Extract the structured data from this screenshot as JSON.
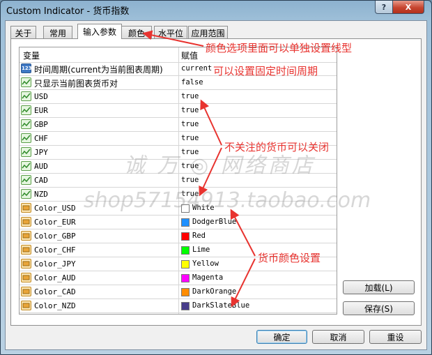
{
  "window": {
    "title": "Custom Indicator - 货币指数",
    "help_label": "?",
    "close_label": "X"
  },
  "tabs": [
    {
      "label": "关于",
      "active": false
    },
    {
      "label": "常用",
      "active": false
    },
    {
      "label": "输入参数",
      "active": true
    },
    {
      "label": "颜色",
      "active": false
    },
    {
      "label": "水平位",
      "active": false
    },
    {
      "label": "应用范围",
      "active": false
    }
  ],
  "grid": {
    "columns": {
      "variable": "变量",
      "value": "赋值"
    },
    "rows": [
      {
        "name": "时间周期(current为当前图表周期)",
        "value": "current",
        "icon": "numeric-param-icon"
      },
      {
        "name": "只显示当前图表货币对",
        "value": "false",
        "icon": "bool-param-icon"
      },
      {
        "name": "USD",
        "value": "true",
        "icon": "bool-param-icon"
      },
      {
        "name": "EUR",
        "value": "true",
        "icon": "bool-param-icon"
      },
      {
        "name": "GBP",
        "value": "true",
        "icon": "bool-param-icon"
      },
      {
        "name": "CHF",
        "value": "true",
        "icon": "bool-param-icon"
      },
      {
        "name": "JPY",
        "value": "true",
        "icon": "bool-param-icon"
      },
      {
        "name": "AUD",
        "value": "true",
        "icon": "bool-param-icon"
      },
      {
        "name": "CAD",
        "value": "true",
        "icon": "bool-param-icon"
      },
      {
        "name": "NZD",
        "value": "true",
        "icon": "bool-param-icon"
      },
      {
        "name": "Color_USD",
        "value": "White",
        "icon": "color-param-icon",
        "color": "#ffffff"
      },
      {
        "name": "Color_EUR",
        "value": "DodgerBlue",
        "icon": "color-param-icon",
        "color": "#1e90ff"
      },
      {
        "name": "Color_GBP",
        "value": "Red",
        "icon": "color-param-icon",
        "color": "#ff0000"
      },
      {
        "name": "Color_CHF",
        "value": "Lime",
        "icon": "color-param-icon",
        "color": "#00ff00"
      },
      {
        "name": "Color_JPY",
        "value": "Yellow",
        "icon": "color-param-icon",
        "color": "#ffff00"
      },
      {
        "name": "Color_AUD",
        "value": "Magenta",
        "icon": "color-param-icon",
        "color": "#ff00ff"
      },
      {
        "name": "Color_CAD",
        "value": "DarkOrange",
        "icon": "color-param-icon",
        "color": "#ff8c00"
      },
      {
        "name": "Color_NZD",
        "value": "DarkSlateBlue",
        "icon": "color-param-icon",
        "color": "#483d8b"
      }
    ]
  },
  "side_buttons": {
    "load": "加载(L)",
    "save": "保存(S)"
  },
  "footer_buttons": {
    "ok": "确定",
    "cancel": "取消",
    "reset": "重设"
  },
  "annotations": {
    "color_tab_note": "颜色选项里面可以单独设置线型",
    "timeframe_note": "可以设置固定时间周期",
    "currency_note": "不关注的货币可以关闭",
    "color_note": "货币颜色设置",
    "color": "#e8332f"
  },
  "watermark": {
    "line1": "诚 万 ◎ 网络商店",
    "line2": "shop57154913.taobao.com"
  }
}
